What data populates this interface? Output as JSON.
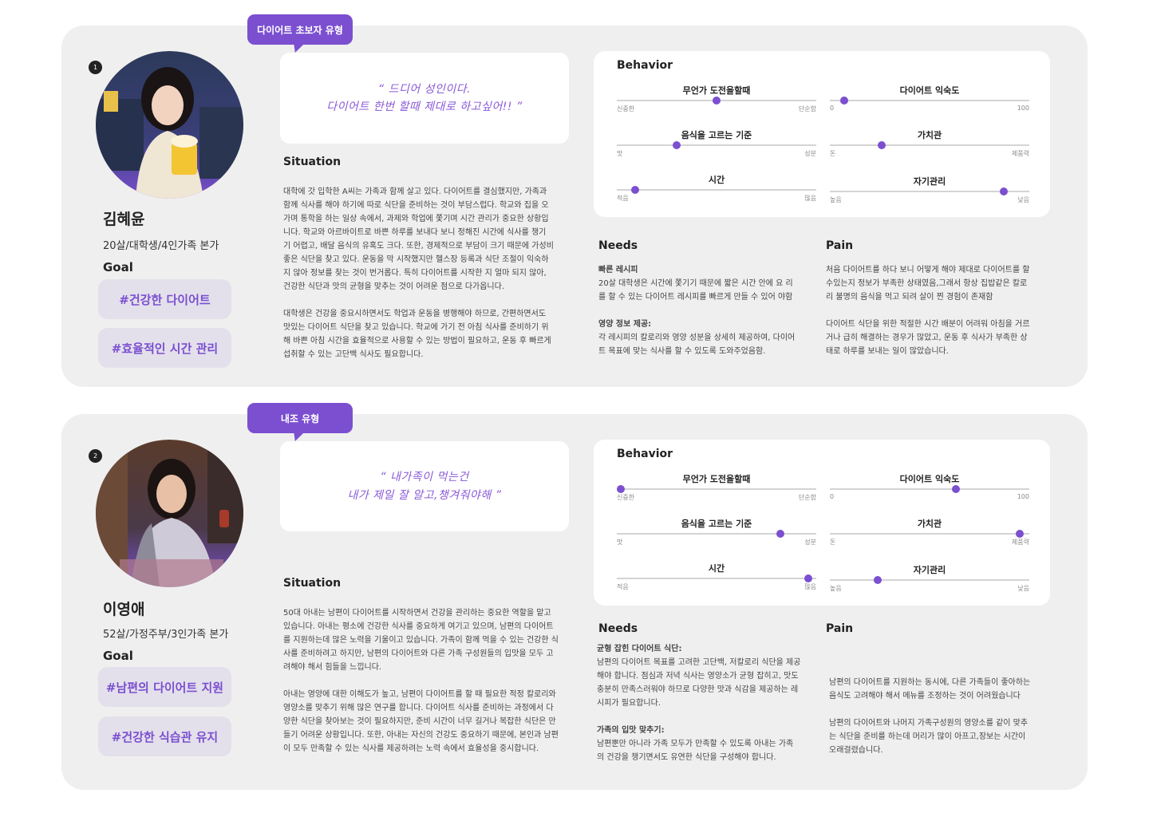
{
  "personas": [
    {
      "number": "1",
      "badge": "다이어트 초보자 유형",
      "name": "김혜윤",
      "info": "20살/대학생/4인가족 본가",
      "goal_label": "Goal",
      "goals": [
        "#건강한 다이어트",
        "#효율적인 시간 관리"
      ],
      "quote": [
        "“ 드디어 성인이다.",
        "다이어트 한번 할때 제대로 하고싶어!! ”"
      ],
      "situation_title": "Situation",
      "situation": "대학에 갓 입학한 A씨는 가족과 함께 살고 있다. 다이어트를 결심했지만, 가족과\n함께 식사를 해야 하기에 따로 식단을 준비하는 것이 부담스럽다. 학교와 집을 오\n가며 통학을 하는 일상 속에서, 과제와 학업에 쫓기며 시간 관리가 중요한 상황입\n니다. 학교와 아르바이트로 바쁜 하루를 보내다 보니 정해진 시간에 식사를 챙기\n기 어렵고, 배달 음식의 유혹도 크다. 또한, 경제적으로 부담이 크기 때문에 가성비\n좋은 식단을 찾고 있다. 운동을 막 시작했지만 헬스장 등록과 식단 조절이 익숙하\n지 않아 정보를 찾는 것이 번거롭다. 특히 다이어트를 시작한 지 얼마 되지 않아,\n건강한 식단과 맛의 균형을 맞추는 것이 어려운 점으로 다가옵니다.\n\n대학생은 건강을 중요시하면서도 학업과 운동을 병행해야 하므로, 간편하면서도\n맛있는 다이어트 식단을 찾고 있습니다.  학교에 가기 전 아침 식사를 준비하기 위\n해 바쁜 아침 시간을 효율적으로 사용할 수 있는 방법이 필요하고, 운동 후 빠르게\n섭취할 수 있는 고단백 식사도 필요합니다.",
      "behavior_title": "Behavior",
      "sliders": [
        {
          "label": "무언가 도전을할때",
          "min": "신중한",
          "max": "단순함",
          "value": 0.5
        },
        {
          "label": "다이어트 익숙도",
          "min": "0",
          "max": "100",
          "value": 0.07
        },
        {
          "label": "음식을 고르는 기준",
          "min": "맛",
          "max": "성분",
          "value": 0.3
        },
        {
          "label": "가치관",
          "min": "돈",
          "max": "제품력",
          "value": 0.26
        },
        {
          "label": "시간",
          "min": "적음",
          "max": "많음",
          "value": 0.09
        },
        {
          "label": "자기관리",
          "min": "높음",
          "max": "낮음",
          "value": 0.87
        }
      ],
      "needs_title": "Needs",
      "needs": [
        {
          "head": "빠른 레시피",
          "body": " 20살 대학생은 시간에 쫓기기 때문에 짧은 시간 안에 요  리\n를 할 수 있는 다이어트 레시피를 빠르게 만들 수 있어 야함"
        },
        {
          "head": "영양 정보 제공:",
          "body": " 각 레시피의 칼로리와 영양 성분을 상세히 제공하여, 다이어\n트 목표에 맞는 식사를 할 수 있도록 도와주었음함."
        }
      ],
      "pain_title": "Pain",
      "pain": "처음 다이어트를 하다 보니 어떻게 해야 제대로 다이어트를 할\n수있는지 정보가 부족한 상태였음,그래서 항상 집밥같은 칼로\n리 불명의 음식을 먹고 되려 살이 찐 경험이 존재함\n\n다이어트 식단을 위한 적절한 시간 배분이 어려워 아침을 거르\n거나 급히 해결하는 경우가 많았고, 운동 후 식사가 부족한 상\n태로 하루를 보내는 일이 많았습니다."
    },
    {
      "number": "2",
      "badge": "내조 유형",
      "name": "이영애",
      "info": "52살/가정주부/3인가족 본가",
      "goal_label": "Goal",
      "goals": [
        "#남편의 다이어트 지원",
        "#건강한 식습관 유지"
      ],
      "quote": [
        "“ 내가족이 먹는건",
        "내가 제일 잘 알고,챙겨줘야해 ”"
      ],
      "situation_title": "Situation",
      "situation": "50대 아내는 남편이 다이어트를 시작하면서 건강을 관리하는 중요한 역할을 맡고\n있습니다. 아내는 평소에 건강한 식사를 중요하게 여기고 있으며, 남편의 다이어트\n를 지원하는데 많은 노력을 기울이고 있습니다. 가족이 함께 먹을 수 있는 건강한 식\n사를 준비하려고 하지만, 남편의 다이어트와 다른 가족 구성원들의 입맛을 모두 고\n려해야 해서 힘들을 느낍니다.\n\n아내는 영양에 대한 이해도가 높고, 남편이 다이어트를 할 때 필요한 적정 칼로리와\n영양소를 맞추기 위해 많은 연구를 합니다. 다이어트 식사를 준비하는 과정에서 다\n양한 식단을 찾아보는 것이 필요하지만, 준비 시간이 너무 길거나 복잡한 식단은 만\n들기 어려운 상황입니다. 또한, 아내는 자신의 건강도 중요하기 때문에, 본인과 남편\n이 모두 만족할 수 있는 식사를 제공하려는 노력 속에서 효율성을 중시합니다.",
      "behavior_title": "Behavior",
      "sliders": [
        {
          "label": "무언가 도전을할때",
          "min": "신중한",
          "max": "단순함",
          "value": 0.02
        },
        {
          "label": "다이어트 익숙도",
          "min": "0",
          "max": "100",
          "value": 0.63
        },
        {
          "label": "음식을 고르는 기준",
          "min": "맛",
          "max": "성분",
          "value": 0.82
        },
        {
          "label": "가치관",
          "min": "돈",
          "max": "제품력",
          "value": 0.95
        },
        {
          "label": "시간",
          "min": "적음",
          "max": "많음",
          "value": 0.96
        },
        {
          "label": "자기관리",
          "min": "높음",
          "max": "낮음",
          "value": 0.24
        }
      ],
      "needs_title": "Needs",
      "needs": [
        {
          "head": "균형 잡힌 다이어트 식단:",
          "body": "남편의 다이어트 목표를 고려한 고단백, 저칼로리 식단을 제공\n해야 합니다. 점심과 저녁 식사는 영양소가 균형 잡히고, 맛도\n충분히 만족스러워야 하므로 다양한 맛과 식감을 제공하는 레\n시피가 필요합니다."
        },
        {
          "head": "가족의 입맛 맞추기:",
          "body": " 남편뿐만 아니라 가족 모두가 만족할 수 있도록  아내는 가족\n의 건강을 챙기면서도 유연한 식단을 구성해야 합니다."
        }
      ],
      "pain_title": "Pain",
      "pain": "남편의 다이어트를 지원하는 동시에, 다른 가족들이 좋아하는\n음식도 고려해야 해서 메뉴를 조정하는 것이 어려웠습니다\n\n남편의 다이어트와 나머지 가족구성원의 영양소를 같이 맞추\n는 식단을 준비를 하는데 머리가 많이 아프고,장보는 시간이\n오래걸렸습니다."
    }
  ],
  "colors": {
    "accent": "#7b4fd0",
    "card": "#efefef",
    "goal_bg": "#e3e0eb"
  }
}
